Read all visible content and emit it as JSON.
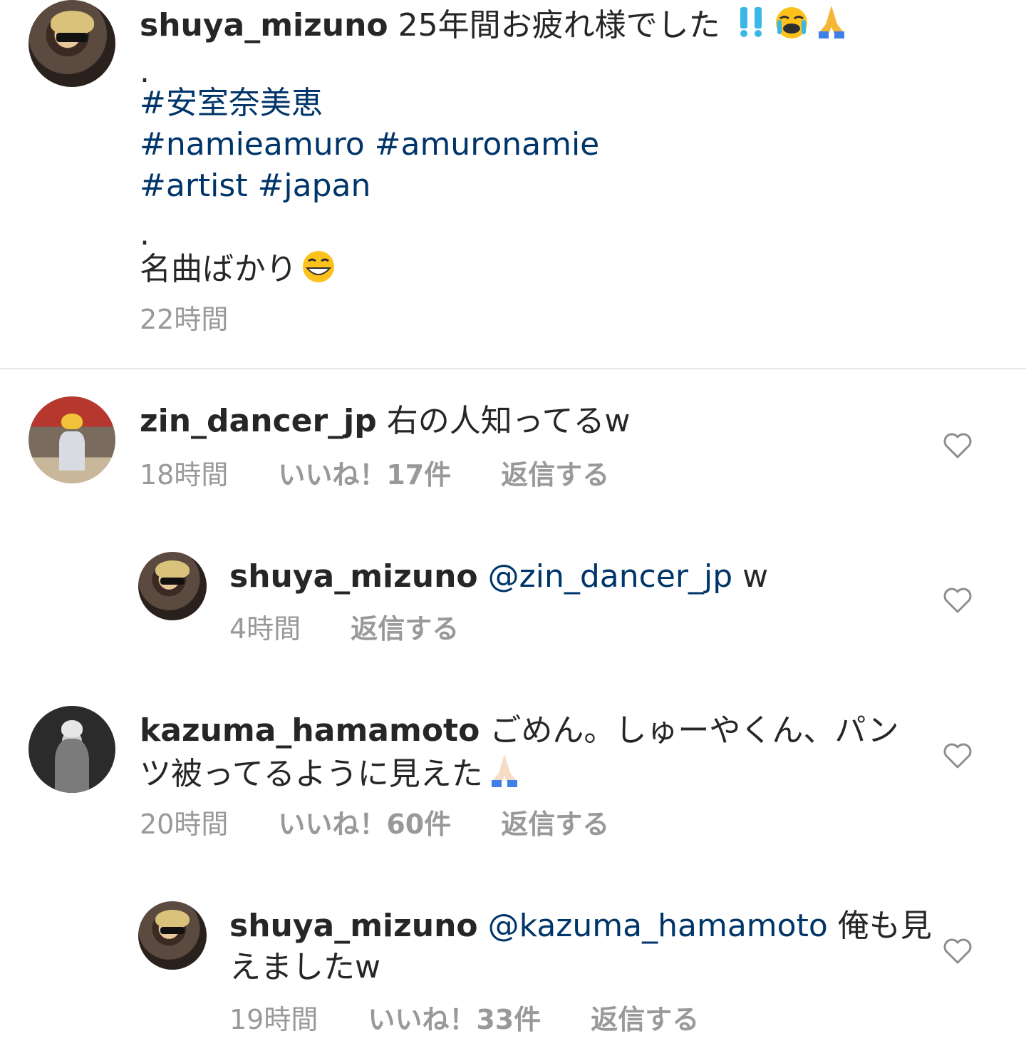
{
  "caption": {
    "username": "shuya_mizuno",
    "text_line1": "25年間お疲れ様でした",
    "dot1": ".",
    "tag_line1": "#安室奈美恵",
    "tag_line2": "#namieamuro #amuronamie",
    "tag_line3": "#artist #japan",
    "dot2": ".",
    "text_line2": "名曲ばかり",
    "time": "22時間"
  },
  "comments": [
    {
      "username": "zin_dancer_jp",
      "text": "右の人知ってるw",
      "time": "18時間",
      "likes": "いいね！17件",
      "reply": "返信する"
    },
    {
      "username": "shuya_mizuno",
      "mention": "@zin_dancer_jp",
      "text": " w",
      "time": "4時間",
      "reply": "返信する"
    },
    {
      "username": "kazuma_hamamoto",
      "text_line1": "ごめん。しゅーやくん、パン",
      "text_line2": "ツ被ってるように見えた",
      "time": "20時間",
      "likes": "いいね！60件",
      "reply": "返信する"
    },
    {
      "username": "shuya_mizuno",
      "mention": "@kazuma_hamamoto",
      "text_line1": " 俺も見",
      "text_line2": "えましたw",
      "time": "19時間",
      "likes": "いいね！33件",
      "reply": "返信する"
    }
  ],
  "icons": {
    "like": "heart-outline-icon",
    "emoji_cry": "loudly-crying-face-emoji",
    "emoji_pray": "folded-hands-emoji",
    "emoji_bangbang": "double-exclamation-emoji",
    "emoji_grin": "grinning-face-emoji"
  },
  "colors": {
    "hashtag": "#003569",
    "meta": "#999999",
    "text": "#262626"
  }
}
